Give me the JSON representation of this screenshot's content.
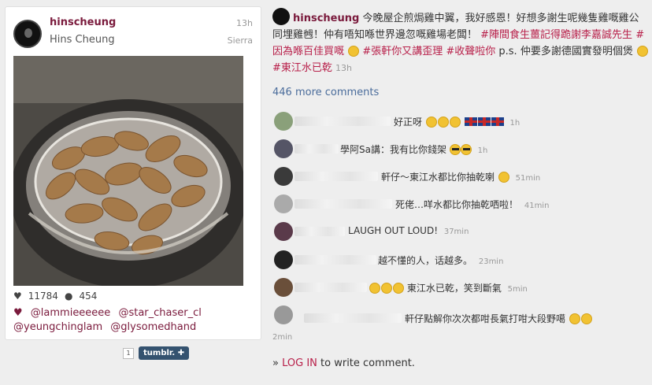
{
  "post": {
    "username": "hinscheung",
    "full_name": "Hins Cheung",
    "time": "13h",
    "filter": "Sierra",
    "likes": "11784",
    "comments_count": "454",
    "likers": [
      "@lammieeeeee",
      "@star_chaser_cl",
      "@yeungchinglam",
      "@glysomedhand"
    ]
  },
  "share": {
    "count": "1",
    "tumblr_label": "tumblr. ✚"
  },
  "caption": {
    "username": "hinscheung",
    "text1": "今晚屋企煎焗雞中翼，我好感恩！好想多謝生呢幾隻雞嘅雞公同埋雞乸！仲有唔知喺世界邊忽嘅雞場老闆！",
    "tag1": "#陣間食生薑記得跪謝李嘉誠先生",
    "tag2": "#因為喺百佳買嘅",
    "tag3": "#張軒你又講歪理",
    "tag4": "#收聲啦你",
    "text2": "p.s. 仲要多謝德國實發明個煲",
    "tag5": "#東江水已乾",
    "time": "13h"
  },
  "more_comments": "446 more comments",
  "comments": [
    {
      "text": "好正呀",
      "time": "1h"
    },
    {
      "text": "學阿Sa講：我有比你錢架",
      "time": "1h"
    },
    {
      "text": "軒仔～東江水都比你抽乾喇",
      "time": "51min"
    },
    {
      "text": "死佬…咩水都比你抽乾哂啦！",
      "time": "41min"
    },
    {
      "text": "LAUGH OUT LOUD!",
      "time": "37min"
    },
    {
      "text": "越不懂的人，话越多。",
      "time": "23min"
    },
    {
      "text": "東江水已乾，笑到斷氣",
      "time": "5min"
    },
    {
      "text": "軒仔點解你次次都咁長氣打咁大段野噶",
      "time": "2min"
    }
  ],
  "login": {
    "prefix": "»",
    "link": "LOG IN",
    "suffix": "to write comment."
  }
}
